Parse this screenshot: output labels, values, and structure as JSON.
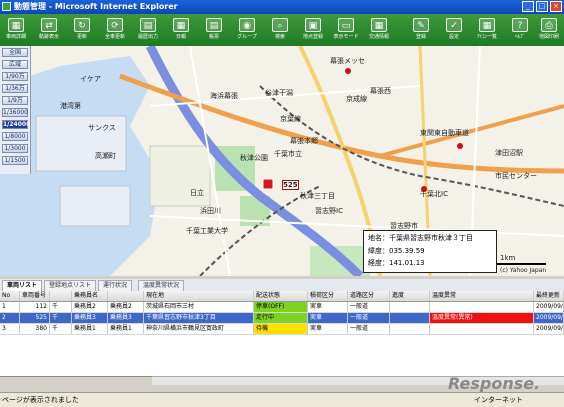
{
  "window": {
    "title": "動態管理 - Microsoft Internet Explorer",
    "minimize": "_",
    "maximize": "□",
    "close": "×"
  },
  "toolbar": {
    "items": [
      {
        "label": "車両詳細",
        "glyph": "▦"
      },
      {
        "label": "軌跡表示",
        "glyph": "⇄"
      },
      {
        "label": "更新",
        "glyph": "↻"
      },
      {
        "label": "全車更新",
        "glyph": "⟳"
      },
      {
        "label": "履歴出力",
        "glyph": "▤"
      },
      {
        "label": "日報",
        "glyph": "▦"
      },
      {
        "label": "帳票",
        "glyph": "▤"
      },
      {
        "label": "グループ",
        "glyph": "◉"
      },
      {
        "label": "検索",
        "glyph": "⌕"
      },
      {
        "label": "地点登録",
        "glyph": "▣"
      },
      {
        "label": "表示モード",
        "glyph": "▭"
      },
      {
        "label": "交通情報",
        "glyph": "▦"
      },
      {
        "label": "登録",
        "glyph": "✎"
      },
      {
        "label": "設定",
        "glyph": "✓"
      },
      {
        "label": "ｱｲｺﾝ一覧",
        "glyph": "▦"
      },
      {
        "label": "ﾍﾙﾌﾟ",
        "glyph": "?"
      },
      {
        "label": "地図印刷",
        "glyph": "⎙"
      }
    ]
  },
  "zoom": {
    "items": [
      "全国",
      "広域",
      "1/90万",
      "1/36万",
      "1/9万",
      "1/36000",
      "1/24000",
      "1/8000",
      "1/3000",
      "1/1500"
    ],
    "selected_index": 6
  },
  "map": {
    "labels": [
      "イケア",
      "港湾第",
      "海浜幕張",
      "幕張メッセ",
      "京葉線",
      "東関東自動車道",
      "千葉北IC",
      "津田沼駅",
      "谷津干潟",
      "秋津公園",
      "千葉市立",
      "浜田川",
      "京成線",
      "幕張本郷",
      "幕張西",
      "秋津三丁目",
      "習志野市",
      "千葉工業大学",
      "日立",
      "サンクス",
      "市民センター",
      "習志野IC",
      "高瀬町"
    ],
    "vehicle_id": "525",
    "info": {
      "address": "地名：千葉県習志野市秋津３丁目",
      "lat": "緯度：035.39.59",
      "lon": "経度：141.01.13"
    },
    "scale": "1km",
    "copyright": "(c) Yahoo Japan"
  },
  "tabs": [
    {
      "label": "車両リスト",
      "active": true
    },
    {
      "label": "登録地点リスト",
      "active": false
    },
    {
      "label": "運行状況",
      "active": false
    },
    {
      "label": "温度異常状況",
      "active": false
    }
  ],
  "table": {
    "columns": [
      "No",
      "車両番号",
      "",
      "乗務員名",
      "",
      "現在地",
      "配送状態",
      "積荷区分",
      "道路区分",
      "進度",
      "温度異常",
      "最終更新"
    ],
    "rows": [
      {
        "no": "1",
        "num": "112",
        "code": "千",
        "driver1": "乗務員2",
        "driver2": "乗務員2",
        "location": "茨城県石岡市三村",
        "status": "停車(OFF)",
        "cargo": "実車",
        "road": "一般道",
        "speed": "",
        "temp": "",
        "updated": "2009/09/02",
        "selected": false
      },
      {
        "no": "2",
        "num": "525",
        "code": "千",
        "driver1": "乗務員3",
        "driver2": "乗務員3",
        "location": "千葉県習志野市秋津3丁目",
        "status": "走行中",
        "cargo": "実車",
        "road": "一般道",
        "speed": "",
        "temp": "温度異常(異常)",
        "updated": "2009/09/02",
        "selected": true
      },
      {
        "no": "3",
        "num": "380",
        "code": "千",
        "driver1": "乗務員1",
        "driver2": "乗務員1",
        "location": "神奈川県横浜市鶴見区寛政町",
        "status": "待機",
        "cargo": "実車",
        "road": "一般道",
        "speed": "",
        "temp": "",
        "updated": "2009/09/02",
        "selected": false
      }
    ]
  },
  "statusbar": {
    "text": "ページが表示されました",
    "zone": "インターネット"
  },
  "watermark": "Response.",
  "colors": {
    "status_green": "#7ed321",
    "status_yellow": "#ffe000",
    "temp_alert": "#ee1111",
    "toolbar": "#2a8a2e",
    "selected_row": "#3f66c9"
  }
}
